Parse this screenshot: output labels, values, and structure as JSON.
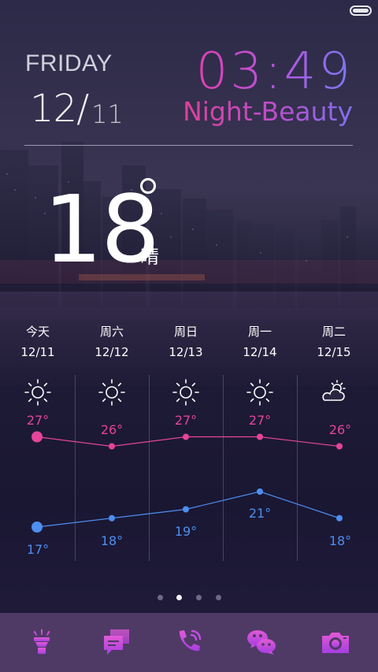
{
  "status": {
    "battery_icon": "battery-icon"
  },
  "header": {
    "day_name": "FRIDAY",
    "date_month": "12/",
    "date_day": "11",
    "time": "03:49",
    "theme_name": "Night-Beauty"
  },
  "current": {
    "temperature": "18",
    "condition": "晴"
  },
  "forecast": [
    {
      "day": "今天",
      "date": "12/11",
      "icon": "sun-icon",
      "high": "27°",
      "low": "17°"
    },
    {
      "day": "周六",
      "date": "12/12",
      "icon": "sun-icon",
      "high": "26°",
      "low": "18°"
    },
    {
      "day": "周日",
      "date": "12/13",
      "icon": "sun-icon",
      "high": "27°",
      "low": "19°"
    },
    {
      "day": "周一",
      "date": "12/14",
      "icon": "sun-icon",
      "high": "27°",
      "low": "21°"
    },
    {
      "day": "周二",
      "date": "12/15",
      "icon": "partly-cloudy-icon",
      "high": "26°",
      "low": "18°"
    }
  ],
  "chart_data": {
    "type": "line",
    "categories": [
      "12/11",
      "12/12",
      "12/13",
      "12/14",
      "12/15"
    ],
    "series": [
      {
        "values": [
          27,
          26,
          27,
          27,
          26
        ]
      },
      {
        "values": [
          17,
          18,
          19,
          21,
          18
        ]
      }
    ],
    "colors": {
      "high": "#e5449a",
      "low": "#4d8ef0"
    }
  },
  "pager": {
    "count": 4,
    "active_index": 1
  },
  "dock": [
    {
      "icon": "flashlight-icon"
    },
    {
      "icon": "messages-icon"
    },
    {
      "icon": "phone-icon"
    },
    {
      "icon": "wechat-icon"
    },
    {
      "icon": "camera-icon"
    }
  ],
  "colors": {
    "accent_pink": "#e5449a",
    "accent_blue": "#4d8ef0",
    "dock_bg": "#4f3a66"
  }
}
